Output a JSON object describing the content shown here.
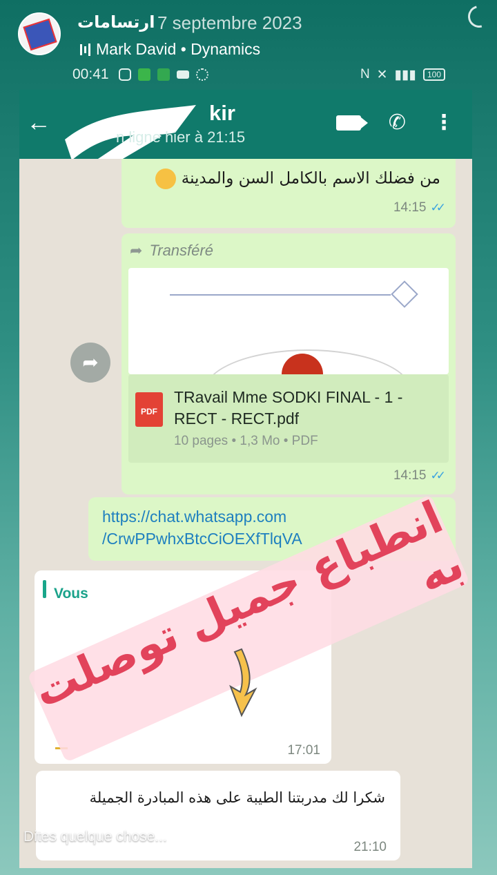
{
  "story": {
    "account_name": "ارتسامات",
    "date": "7 septembre 2023",
    "music": "Mark David • Dynamics"
  },
  "status_bar": {
    "time": "00:41",
    "battery": "100"
  },
  "chat_header": {
    "contact_name_visible": "kir",
    "last_seen": "n ligne hier à 21:15"
  },
  "messages": {
    "m1": {
      "text": "من فضلك الاسم بالكامل السن والمدينة",
      "time": "14:15"
    },
    "m2": {
      "forwarded_label": "Transféré",
      "file_name": "TRavail Mme SODKI FINAL - 1 - RECT - RECT.pdf",
      "file_info": "10 pages • 1,3 Mo • PDF",
      "file_type": "PDF",
      "time": "14:15"
    },
    "m3": {
      "link": "https://chat.whatsapp.com /CrwPPwhxBtcCiOEXfTlqVA"
    },
    "m4": {
      "quote_author": "Vous",
      "time": "17:01"
    },
    "m5": {
      "text": "شكرا لك مدربتنا الطيبة على هذه المبادرة الجميلة",
      "time": "21:10"
    }
  },
  "overlay": {
    "sticker_text": "انطباع جميل توصلت به"
  },
  "reply_placeholder": "Dites quelque chose...",
  "colors": {
    "header_green": "#107a6b",
    "outgoing_bubble": "#dcf7c7",
    "incoming_bubble": "#ffffff",
    "sticker_text": "#e2435b",
    "read_ticks": "#39a2e0"
  }
}
